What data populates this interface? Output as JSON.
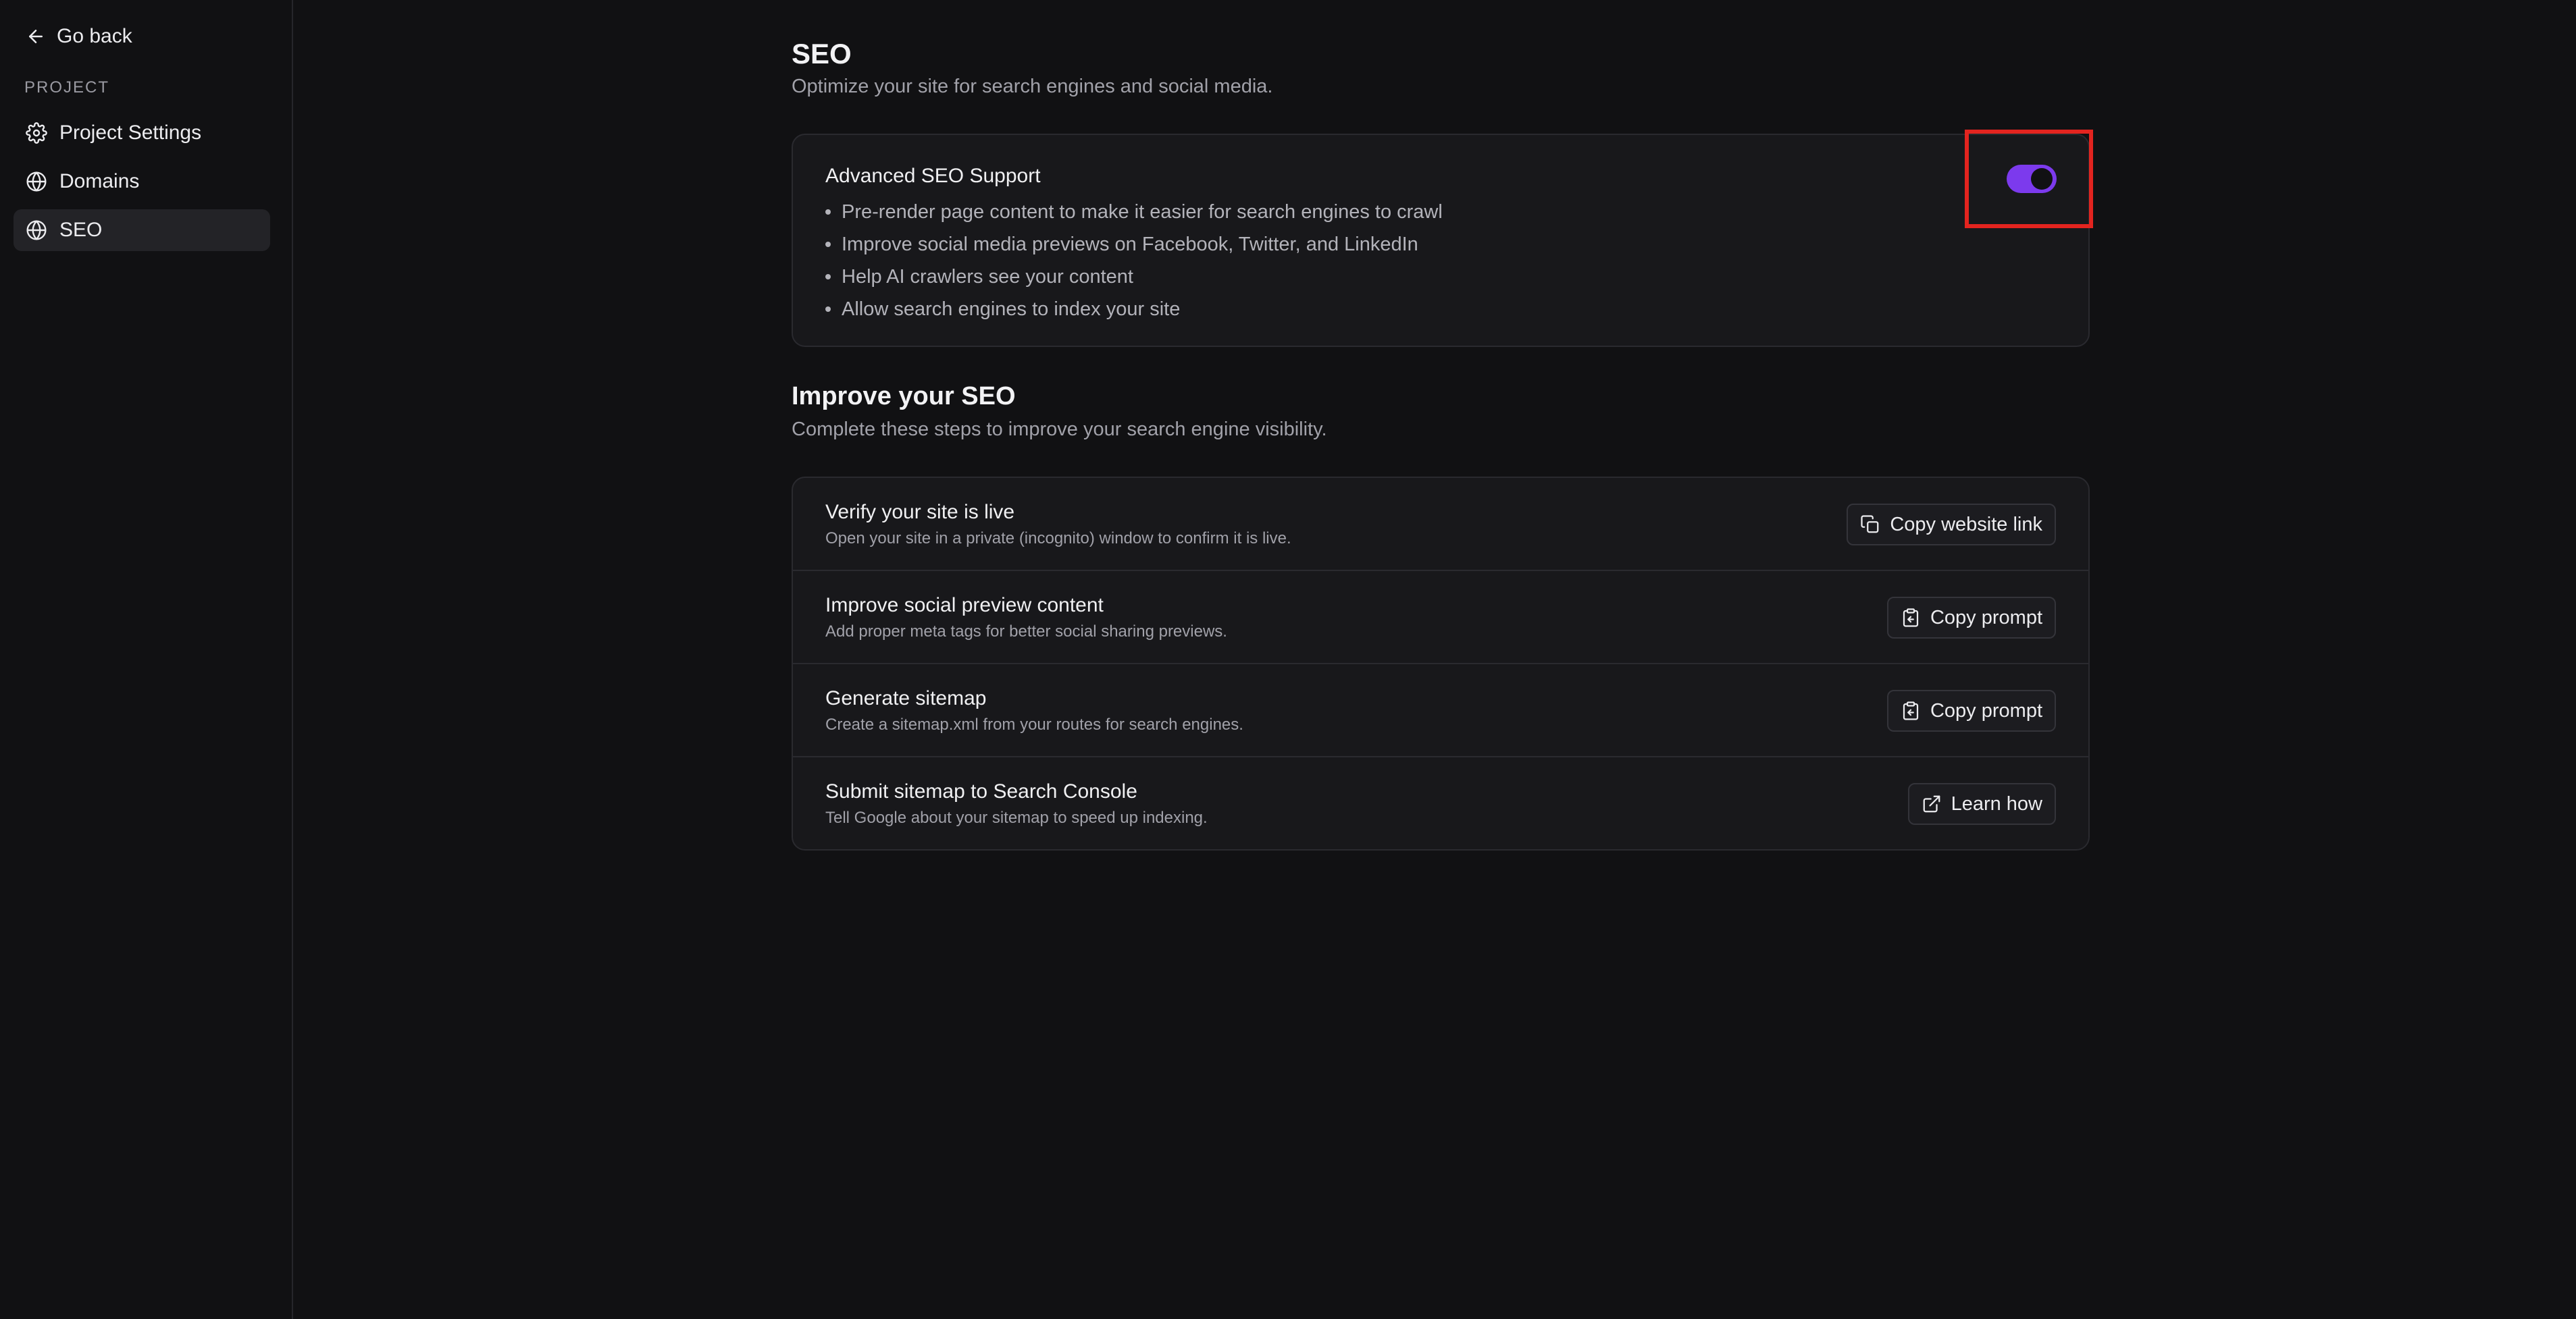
{
  "sidebar": {
    "go_back": "Go back",
    "section_label": "PROJECT",
    "items": [
      {
        "label": "Project Settings",
        "icon": "gear-icon"
      },
      {
        "label": "Domains",
        "icon": "globe-icon"
      },
      {
        "label": "SEO",
        "icon": "globe-icon",
        "active": true
      }
    ]
  },
  "header": {
    "title": "SEO",
    "subtitle": "Optimize your site for search engines and social media."
  },
  "advanced_seo": {
    "title": "Advanced SEO Support",
    "enabled": true,
    "toggle_color": "#7c3aed",
    "highlight_color": "#e3241f",
    "bullets": [
      "Pre-render page content to make it easier for search engines to crawl",
      "Improve social media previews on Facebook, Twitter, and LinkedIn",
      "Help AI crawlers see your content",
      "Allow search engines to index your site"
    ]
  },
  "improve": {
    "title": "Improve your SEO",
    "subtitle": "Complete these steps to improve your search engine visibility.",
    "steps": [
      {
        "title": "Verify your site is live",
        "description": "Open your site in a private (incognito) window to confirm it is live.",
        "button": "Copy website link",
        "icon": "copy-icon"
      },
      {
        "title": "Improve social preview content",
        "description": "Add proper meta tags for better social sharing previews.",
        "button": "Copy prompt",
        "icon": "clipboard-icon"
      },
      {
        "title": "Generate sitemap",
        "description": "Create a sitemap.xml from your routes for search engines.",
        "button": "Copy prompt",
        "icon": "clipboard-icon"
      },
      {
        "title": "Submit sitemap to Search Console",
        "description": "Tell Google about your sitemap to speed up indexing.",
        "button": "Learn how",
        "icon": "external-link-icon"
      }
    ]
  }
}
